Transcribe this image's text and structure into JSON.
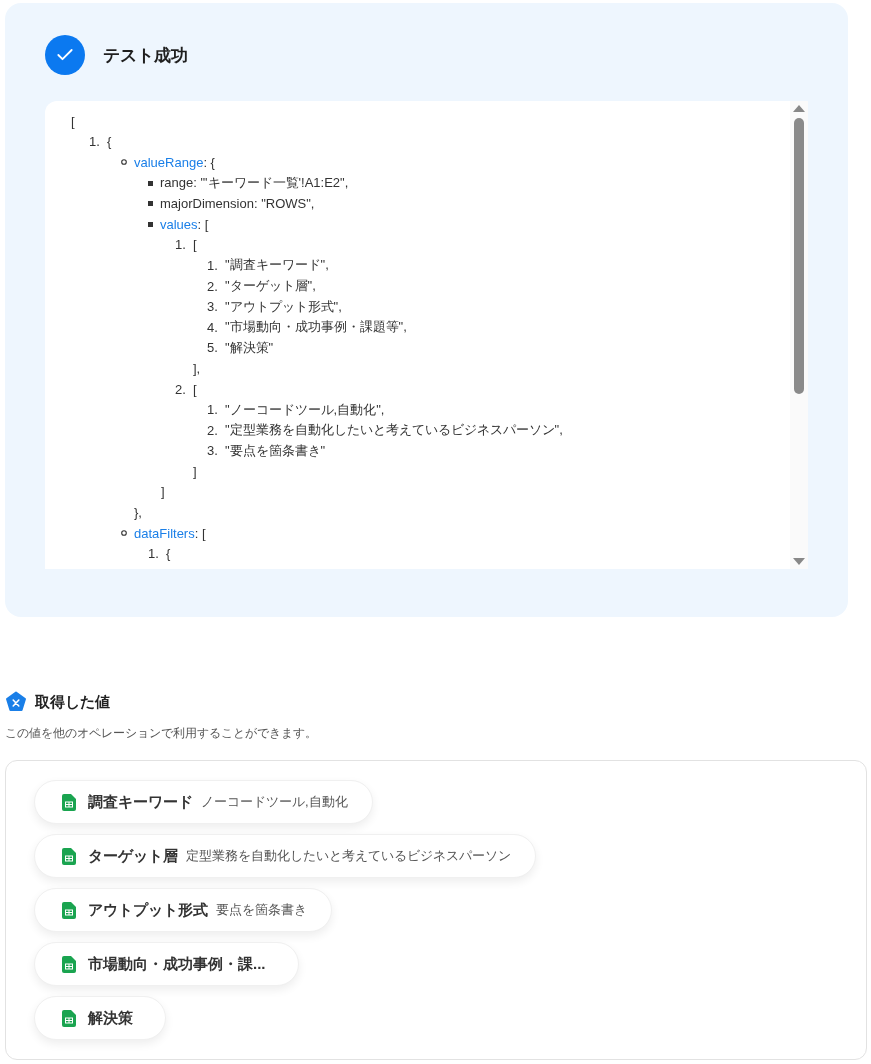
{
  "result": {
    "title": "テスト成功"
  },
  "output_tree": [
    {
      "kind": "plain",
      "text": "[",
      "children": [
        {
          "kind": "numbered",
          "marker": "1.",
          "text": "{",
          "children": [
            {
              "kind": "circle",
              "key": "valueRange",
              "text": ": {",
              "close": "},",
              "children": [
                {
                  "kind": "square",
                  "text": "range: \"'キーワード一覧'!A1:E2\","
                },
                {
                  "kind": "square",
                  "text": "majorDimension: \"ROWS\","
                },
                {
                  "kind": "square",
                  "key": "values",
                  "text": ": [",
                  "close": "]",
                  "children": [
                    {
                      "kind": "numbered",
                      "marker": "1.",
                      "text": "[",
                      "close": "],",
                      "children": [
                        {
                          "kind": "numbered",
                          "marker": "1.",
                          "text": "\"調査キーワード\","
                        },
                        {
                          "kind": "numbered",
                          "marker": "2.",
                          "text": "\"ターゲット層\","
                        },
                        {
                          "kind": "numbered",
                          "marker": "3.",
                          "text": "\"アウトプット形式\","
                        },
                        {
                          "kind": "numbered",
                          "marker": "4.",
                          "text": "\"市場動向・成功事例・課題等\","
                        },
                        {
                          "kind": "numbered",
                          "marker": "5.",
                          "text": "\"解決策\""
                        }
                      ]
                    },
                    {
                      "kind": "numbered",
                      "marker": "2.",
                      "text": "[",
                      "close": "]",
                      "children": [
                        {
                          "kind": "numbered",
                          "marker": "1.",
                          "text": "\"ノーコードツール,自動化\","
                        },
                        {
                          "kind": "numbered",
                          "marker": "2.",
                          "text": "\"定型業務を自動化したいと考えているビジネスパーソン\","
                        },
                        {
                          "kind": "numbered",
                          "marker": "3.",
                          "text": "\"要点を箇条書き\""
                        }
                      ]
                    }
                  ]
                }
              ]
            },
            {
              "kind": "circle",
              "key": "dataFilters",
              "text": ": [",
              "children": [
                {
                  "kind": "numbered",
                  "marker": "1.",
                  "text": "{"
                }
              ]
            }
          ]
        }
      ]
    }
  ],
  "values_section": {
    "title": "取得した値",
    "description": "この値を他のオペレーションで利用することができます。",
    "chips": [
      {
        "label": "調査キーワード",
        "value": "ノーコードツール,自動化"
      },
      {
        "label": "ターゲット層",
        "value": "定型業務を自動化したいと考えているビジネスパーソン"
      },
      {
        "label": "アウトプット形式",
        "value": "要点を箇条書き"
      },
      {
        "label": "市場動向・成功事例・課..."
      },
      {
        "label": "解決策"
      }
    ]
  }
}
